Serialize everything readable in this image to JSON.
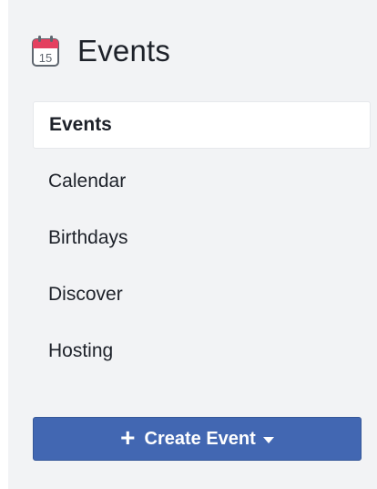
{
  "header": {
    "title": "Events",
    "icon": "calendar-icon",
    "icon_day": "15",
    "icon_color": "#e4405f"
  },
  "nav": {
    "items": [
      {
        "label": "Events",
        "active": true
      },
      {
        "label": "Calendar",
        "active": false
      },
      {
        "label": "Birthdays",
        "active": false
      },
      {
        "label": "Discover",
        "active": false
      },
      {
        "label": "Hosting",
        "active": false
      }
    ]
  },
  "create_button": {
    "label": "Create Event",
    "icon_left": "plus-icon",
    "icon_right": "caret-down-icon",
    "color": "#4267b2"
  }
}
